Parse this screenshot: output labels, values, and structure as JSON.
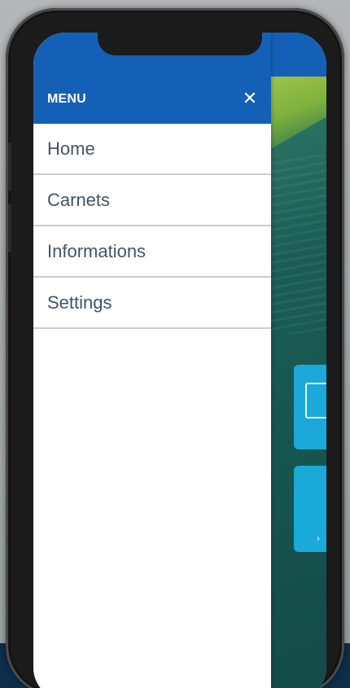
{
  "drawer": {
    "title": "MENU",
    "close_icon": "close-icon",
    "close_glyph": "✕",
    "items": [
      {
        "label": "Home"
      },
      {
        "label": "Carnets"
      },
      {
        "label": "Informations"
      },
      {
        "label": "Settings"
      }
    ]
  },
  "colors": {
    "header_blue": "#1560b7",
    "menu_text": "#425466",
    "tile_blue": "#1aa9d8",
    "hero_green": "#1c5a54"
  }
}
